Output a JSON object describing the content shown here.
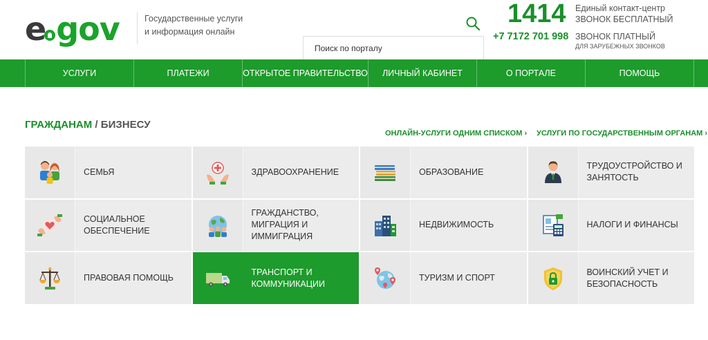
{
  "header": {
    "logo": {
      "e": "e",
      "gov": "gov"
    },
    "tagline_line1": "Государственные услуги",
    "tagline_line2": "и информация онлайн",
    "search_placeholder": "Поиск по порталу",
    "phone_short": "1414",
    "contact_center": "Единый контакт-центр",
    "free_call": "ЗВОНОК БЕСПЛАТНЫЙ",
    "phone_long": "+7 7172 701 998",
    "paid_call": "ЗВОНОК ПЛАТНЫЙ",
    "foreign_calls": "ДЛЯ ЗАРУБЕЖНЫХ ЗВОНКОВ"
  },
  "nav": {
    "items": [
      {
        "label": "УСЛУГИ"
      },
      {
        "label": "ПЛАТЕЖИ"
      },
      {
        "label": "ОТКРЫТОЕ ПРАВИТЕЛЬСТВО"
      },
      {
        "label": "ЛИЧНЫЙ КАБИНЕТ"
      },
      {
        "label": "О ПОРТАЛЕ"
      },
      {
        "label": "ПОМОЩЬ"
      }
    ]
  },
  "section": {
    "citizens": "ГРАЖДАНАМ",
    "separator": " / ",
    "business": "БИЗНЕСУ",
    "link_list": "ОНЛАЙН-УСЛУГИ ОДНИМ СПИСКОМ ›",
    "link_orgs": "УСЛУГИ ПО ГОСУДАРСТВЕННЫМ ОРГАНАМ ›"
  },
  "categories": [
    {
      "label": "СЕМЬЯ",
      "icon": "family-icon"
    },
    {
      "label": "ЗДРАВООХРАНЕНИЕ",
      "icon": "healthcare-icon"
    },
    {
      "label": "ОБРАЗОВАНИЕ",
      "icon": "books-icon"
    },
    {
      "label": "ТРУДОУСТРОЙСТВО И ЗАНЯТОСТЬ",
      "icon": "employee-icon"
    },
    {
      "label": "СОЦИАЛЬНОЕ ОБЕСПЕЧЕНИЕ",
      "icon": "heart-hands-icon"
    },
    {
      "label": "ГРАЖДАНСТВО, МИГРАЦИЯ И ИММИГРАЦИЯ",
      "icon": "globe-people-icon"
    },
    {
      "label": "НЕДВИЖИМОСТЬ",
      "icon": "buildings-icon"
    },
    {
      "label": "НАЛОГИ И ФИНАНСЫ",
      "icon": "calculator-icon"
    },
    {
      "label": "ПРАВОВАЯ ПОМОЩЬ",
      "icon": "scales-icon"
    },
    {
      "label": "ТРАНСПОРТ И КОММУНИКАЦИИ",
      "icon": "truck-icon",
      "active": true
    },
    {
      "label": "ТУРИЗМ И СПОРТ",
      "icon": "globe-pins-icon"
    },
    {
      "label": "ВОИНСКИЙ УЧЕТ И БЕЗОПАСНОСТЬ",
      "icon": "shield-lock-icon"
    }
  ],
  "colors": {
    "brand_green": "#1d9b2b",
    "dark_green": "#1a8f2a",
    "tile_bg": "#ececec",
    "logo_gray": "#3a3a3a"
  }
}
